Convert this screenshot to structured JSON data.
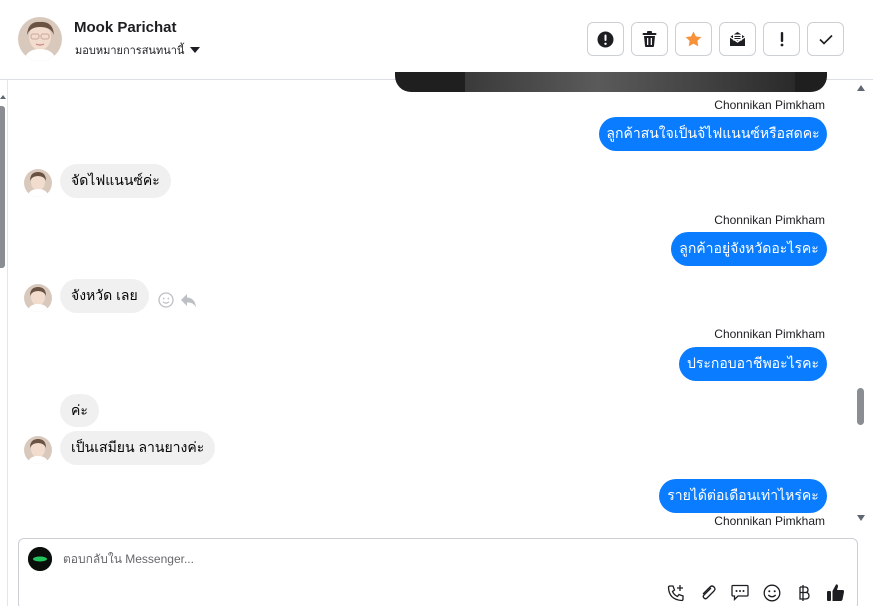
{
  "header": {
    "contact_name": "Mook Parichat",
    "assign_label": "มอบหมายการสนทนานี้",
    "actions": [
      {
        "icon": "alert-circle-icon",
        "name": "spam-button"
      },
      {
        "icon": "trash-icon",
        "name": "delete-button"
      },
      {
        "icon": "star-icon",
        "name": "star-button"
      },
      {
        "icon": "mark-unread-icon",
        "name": "mark-unread-button"
      },
      {
        "icon": "exclamation-icon",
        "name": "follow-up-button"
      },
      {
        "icon": "check-icon",
        "name": "done-button"
      }
    ],
    "star_color": "#f7923b"
  },
  "messages": {
    "out1": {
      "sender": "Chonnikan Pimkham",
      "text": "ลูกค้าสนใจเป็นจ้ไฟแนนซ์หรือสดคะ"
    },
    "in1": {
      "text": "จัดไฟแนนซ์ค่ะ"
    },
    "out2": {
      "sender": "Chonnikan Pimkham",
      "text": "ลูกค้าอยู่จังหวัดอะไรคะ"
    },
    "in2": {
      "text": "จังหวัด เลย"
    },
    "out3": {
      "sender": "Chonnikan Pimkham",
      "text": "ประกอบอาชีพอะไรคะ"
    },
    "in3": {
      "text": "ค่ะ"
    },
    "in4": {
      "text": "เป็นเสมียน ลานยางค่ะ"
    },
    "out4": {
      "sender": "Chonnikan Pimkham",
      "text": "รายได้ต่อเดือนเท่าไหร่คะ"
    }
  },
  "composer": {
    "placeholder": "ตอบกลับใน Messenger..."
  },
  "colors": {
    "outgoing_bubble": "#0a7cff",
    "incoming_bubble": "#f0f0f0",
    "like_icon": "#1c1e21"
  }
}
